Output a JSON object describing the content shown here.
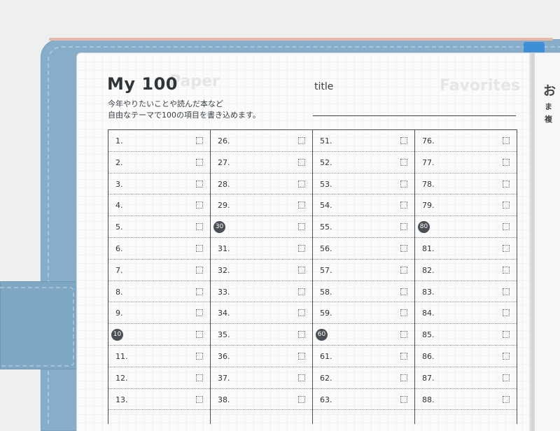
{
  "planner": {
    "title": "My 100",
    "title_label": "title",
    "description_line1": "今年やりたいことや読んだ本など",
    "description_line2": "自由なテーマで100の項目を書き込めます。"
  },
  "background_watermarks": [
    "Paper",
    "Favorites"
  ],
  "right_page": {
    "glyph1": "お",
    "glyph2": "ま",
    "glyph3": "複"
  },
  "columns": [
    {
      "rows": [
        "1.",
        "2.",
        "3.",
        "4.",
        "5.",
        "6.",
        "7.",
        "8.",
        "9.",
        "10",
        "11.",
        "12.",
        "13."
      ],
      "badge_index": 9
    },
    {
      "rows": [
        "26.",
        "27.",
        "28.",
        "29.",
        "30",
        "31.",
        "32.",
        "33.",
        "34.",
        "35.",
        "36.",
        "37.",
        "38."
      ],
      "badge_index": 4
    },
    {
      "rows": [
        "51.",
        "52.",
        "53.",
        "54.",
        "55.",
        "56.",
        "57.",
        "58.",
        "59.",
        "60",
        "61.",
        "62.",
        "63."
      ],
      "badge_index": 9
    },
    {
      "rows": [
        "76.",
        "77.",
        "78.",
        "79.",
        "80",
        "81.",
        "82.",
        "83.",
        "84.",
        "85.",
        "86.",
        "87.",
        "88."
      ],
      "badge_index": 4
    }
  ],
  "colors": {
    "cover": "#86aecb",
    "ink": "#2f3438",
    "badge": "#4a4f55",
    "elastic": "#3f8fd6"
  }
}
